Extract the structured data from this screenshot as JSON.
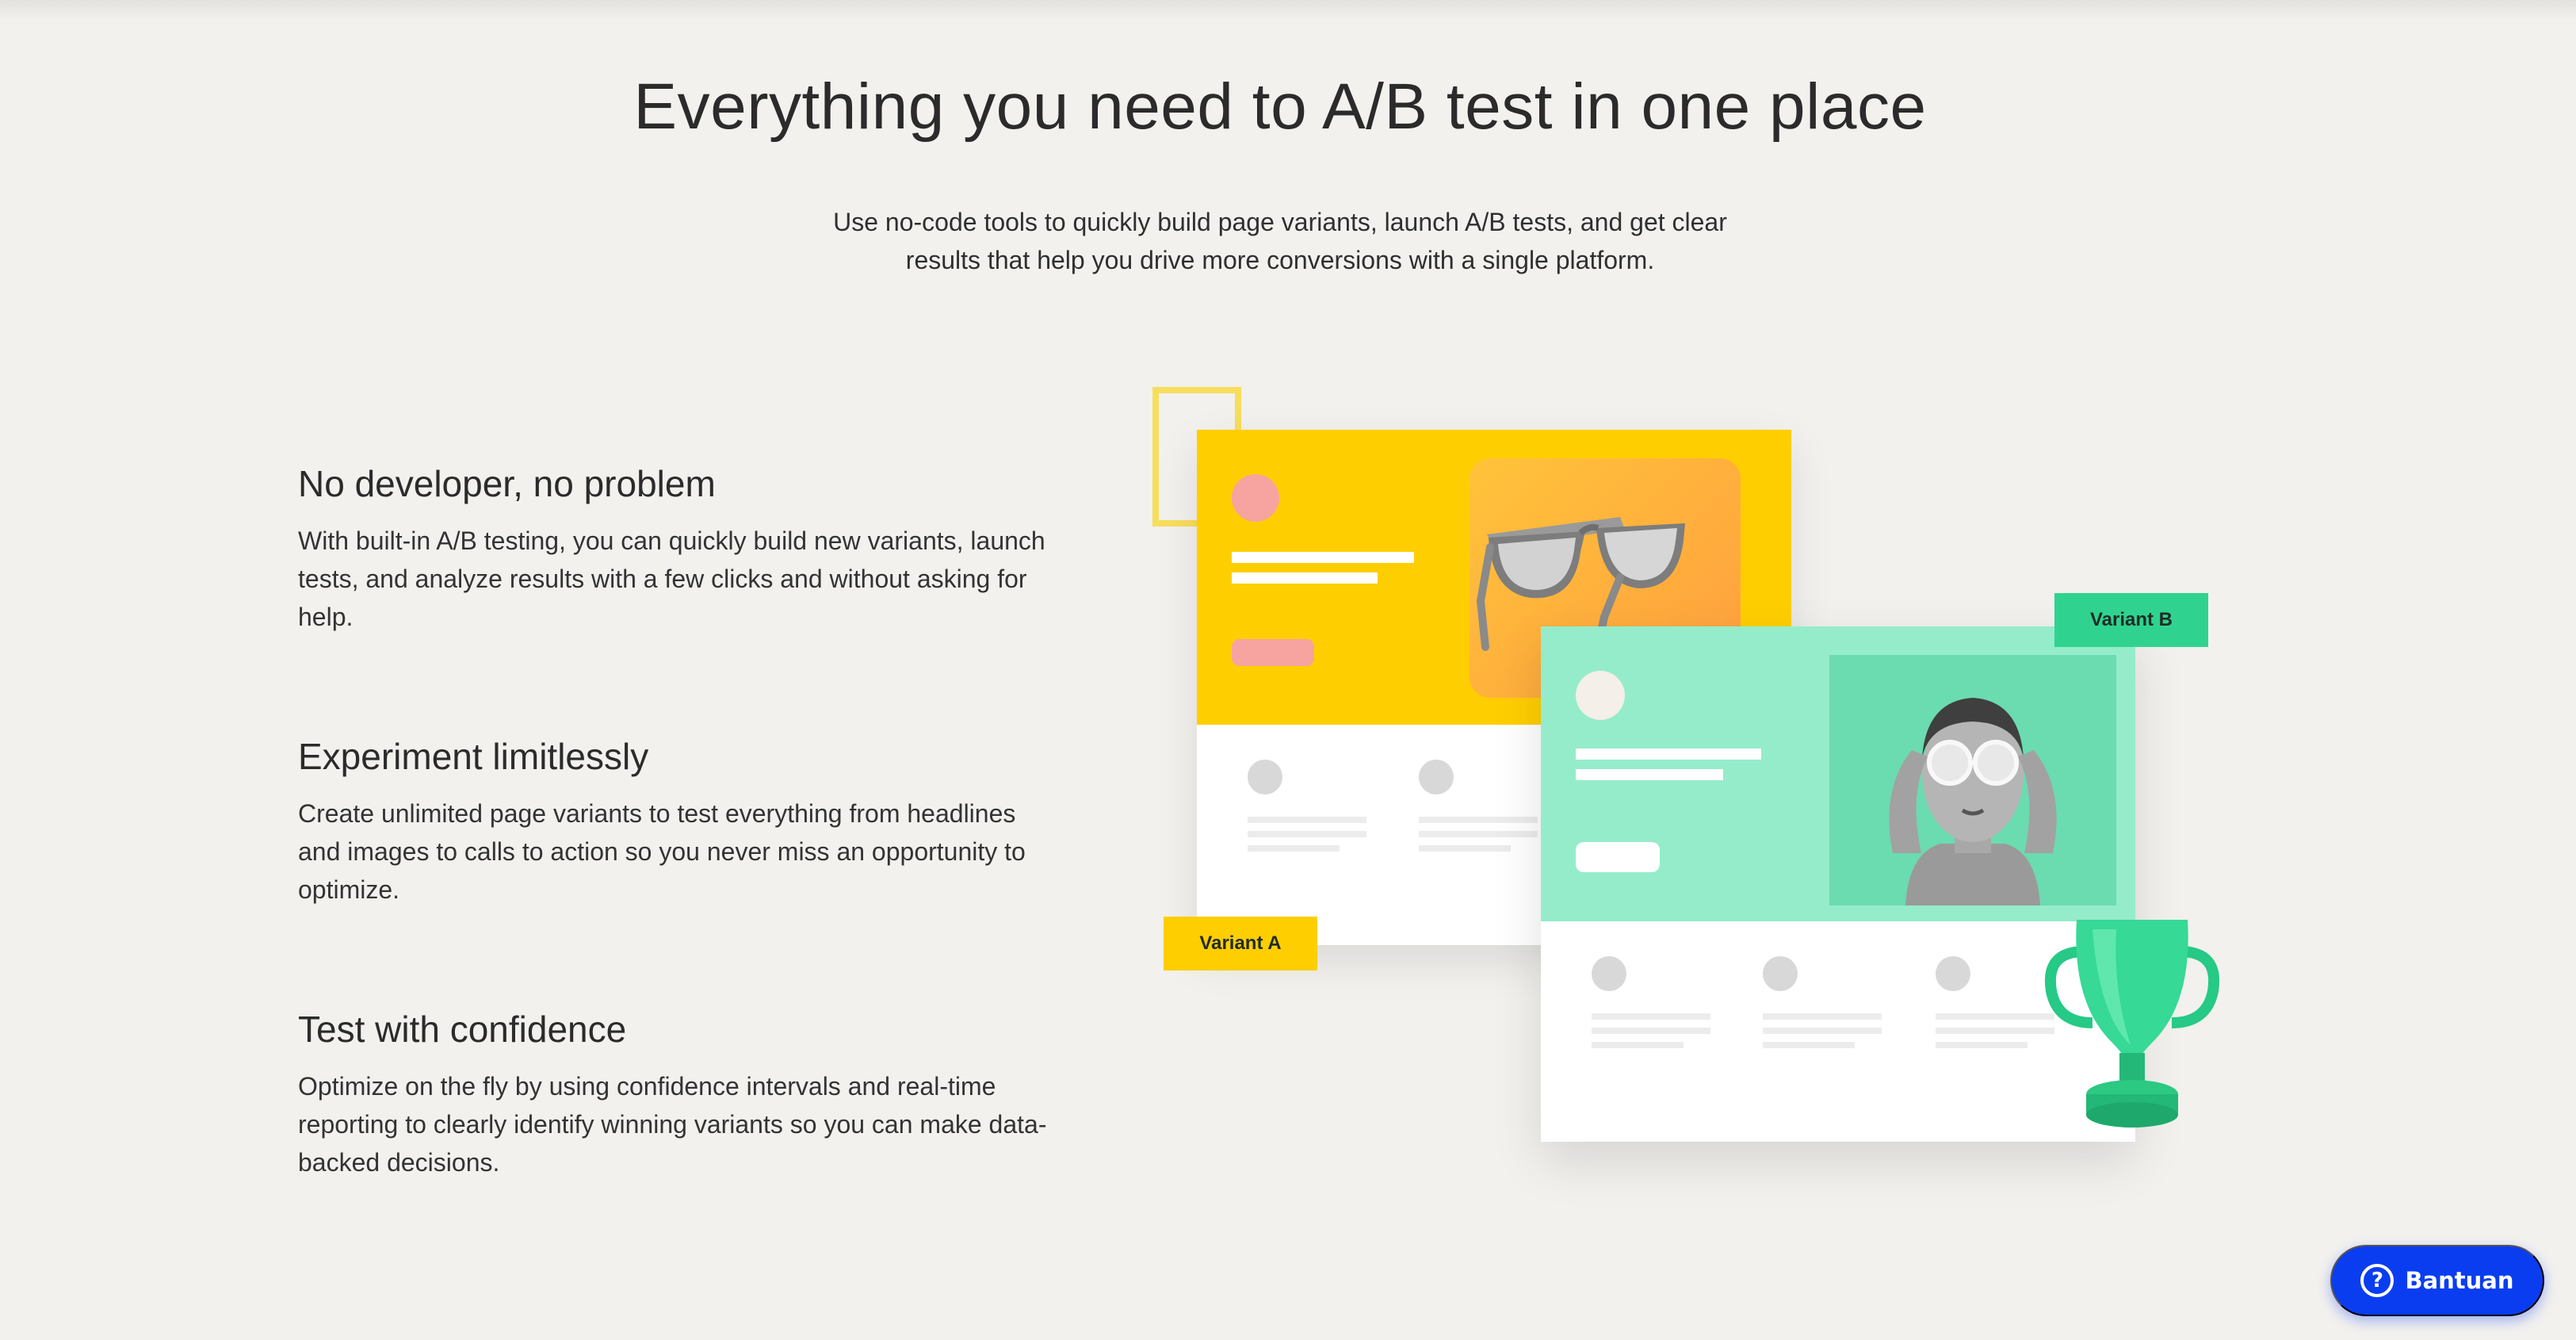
{
  "hero": {
    "title": "Everything you need to A/B test in one place",
    "subtitle": "Use no-code tools to quickly build page variants, launch A/B tests, and get clear results that help you drive more conversions with a single platform."
  },
  "features": [
    {
      "title": "No developer, no problem",
      "body": "With built-in A/B testing, you can quickly build new variants, launch tests, and analyze results with a few clicks and without asking for help."
    },
    {
      "title": "Experiment limitlessly",
      "body": "Create unlimited page variants to test everything from headlines and images to calls to action so you never miss an opportunity to optimize."
    },
    {
      "title": "Test with confidence",
      "body": "Optimize on the fly by using confidence intervals and real-time reporting to clearly identify winning variants so you can make data-backed decisions."
    }
  ],
  "illustration": {
    "variant_a_label": "Variant A",
    "variant_b_label": "Variant B",
    "variant_a_color": "#ffce00",
    "variant_b_color": "#95eccb",
    "tag_b_color": "#2fd38f",
    "icons": [
      "sunglasses-image",
      "woman-with-glasses-image",
      "trophy-icon"
    ]
  },
  "help": {
    "label": "Bantuan",
    "icon": "question-circle-icon",
    "color": "#0b3df0"
  }
}
